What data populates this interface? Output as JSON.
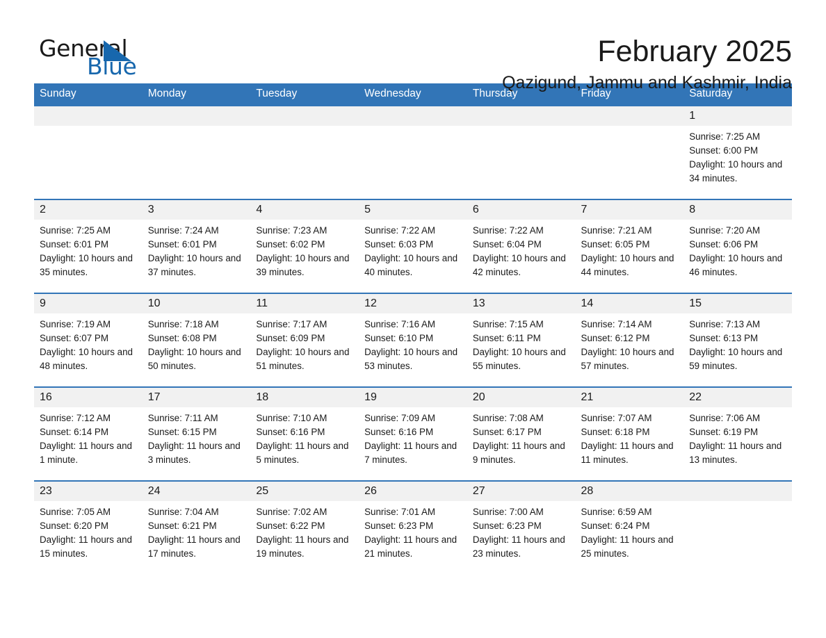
{
  "brand": {
    "name_part1": "General",
    "name_part2": "Blue",
    "flag_icon": "triangle-flag-icon",
    "accent_color": "#1767ad"
  },
  "header": {
    "title": "February 2025",
    "subtitle": "Qazigund, Jammu and Kashmir, India"
  },
  "theme": {
    "header_row_bg": "#3275b7",
    "daynum_bg": "#f1f1f1",
    "row_border": "#3275b7",
    "text": "#1a1a1a"
  },
  "weekday_headers": [
    "Sunday",
    "Monday",
    "Tuesday",
    "Wednesday",
    "Thursday",
    "Friday",
    "Saturday"
  ],
  "weeks": [
    [
      {
        "day": "",
        "sunrise": "",
        "sunset": "",
        "daylight": "",
        "empty": true
      },
      {
        "day": "",
        "sunrise": "",
        "sunset": "",
        "daylight": "",
        "empty": true
      },
      {
        "day": "",
        "sunrise": "",
        "sunset": "",
        "daylight": "",
        "empty": true
      },
      {
        "day": "",
        "sunrise": "",
        "sunset": "",
        "daylight": "",
        "empty": true
      },
      {
        "day": "",
        "sunrise": "",
        "sunset": "",
        "daylight": "",
        "empty": true
      },
      {
        "day": "",
        "sunrise": "",
        "sunset": "",
        "daylight": "",
        "empty": true
      },
      {
        "day": "1",
        "sunrise": "Sunrise: 7:25 AM",
        "sunset": "Sunset: 6:00 PM",
        "daylight": "Daylight: 10 hours and 34 minutes.",
        "empty": false
      }
    ],
    [
      {
        "day": "2",
        "sunrise": "Sunrise: 7:25 AM",
        "sunset": "Sunset: 6:01 PM",
        "daylight": "Daylight: 10 hours and 35 minutes.",
        "empty": false
      },
      {
        "day": "3",
        "sunrise": "Sunrise: 7:24 AM",
        "sunset": "Sunset: 6:01 PM",
        "daylight": "Daylight: 10 hours and 37 minutes.",
        "empty": false
      },
      {
        "day": "4",
        "sunrise": "Sunrise: 7:23 AM",
        "sunset": "Sunset: 6:02 PM",
        "daylight": "Daylight: 10 hours and 39 minutes.",
        "empty": false
      },
      {
        "day": "5",
        "sunrise": "Sunrise: 7:22 AM",
        "sunset": "Sunset: 6:03 PM",
        "daylight": "Daylight: 10 hours and 40 minutes.",
        "empty": false
      },
      {
        "day": "6",
        "sunrise": "Sunrise: 7:22 AM",
        "sunset": "Sunset: 6:04 PM",
        "daylight": "Daylight: 10 hours and 42 minutes.",
        "empty": false
      },
      {
        "day": "7",
        "sunrise": "Sunrise: 7:21 AM",
        "sunset": "Sunset: 6:05 PM",
        "daylight": "Daylight: 10 hours and 44 minutes.",
        "empty": false
      },
      {
        "day": "8",
        "sunrise": "Sunrise: 7:20 AM",
        "sunset": "Sunset: 6:06 PM",
        "daylight": "Daylight: 10 hours and 46 minutes.",
        "empty": false
      }
    ],
    [
      {
        "day": "9",
        "sunrise": "Sunrise: 7:19 AM",
        "sunset": "Sunset: 6:07 PM",
        "daylight": "Daylight: 10 hours and 48 minutes.",
        "empty": false
      },
      {
        "day": "10",
        "sunrise": "Sunrise: 7:18 AM",
        "sunset": "Sunset: 6:08 PM",
        "daylight": "Daylight: 10 hours and 50 minutes.",
        "empty": false
      },
      {
        "day": "11",
        "sunrise": "Sunrise: 7:17 AM",
        "sunset": "Sunset: 6:09 PM",
        "daylight": "Daylight: 10 hours and 51 minutes.",
        "empty": false
      },
      {
        "day": "12",
        "sunrise": "Sunrise: 7:16 AM",
        "sunset": "Sunset: 6:10 PM",
        "daylight": "Daylight: 10 hours and 53 minutes.",
        "empty": false
      },
      {
        "day": "13",
        "sunrise": "Sunrise: 7:15 AM",
        "sunset": "Sunset: 6:11 PM",
        "daylight": "Daylight: 10 hours and 55 minutes.",
        "empty": false
      },
      {
        "day": "14",
        "sunrise": "Sunrise: 7:14 AM",
        "sunset": "Sunset: 6:12 PM",
        "daylight": "Daylight: 10 hours and 57 minutes.",
        "empty": false
      },
      {
        "day": "15",
        "sunrise": "Sunrise: 7:13 AM",
        "sunset": "Sunset: 6:13 PM",
        "daylight": "Daylight: 10 hours and 59 minutes.",
        "empty": false
      }
    ],
    [
      {
        "day": "16",
        "sunrise": "Sunrise: 7:12 AM",
        "sunset": "Sunset: 6:14 PM",
        "daylight": "Daylight: 11 hours and 1 minute.",
        "empty": false
      },
      {
        "day": "17",
        "sunrise": "Sunrise: 7:11 AM",
        "sunset": "Sunset: 6:15 PM",
        "daylight": "Daylight: 11 hours and 3 minutes.",
        "empty": false
      },
      {
        "day": "18",
        "sunrise": "Sunrise: 7:10 AM",
        "sunset": "Sunset: 6:16 PM",
        "daylight": "Daylight: 11 hours and 5 minutes.",
        "empty": false
      },
      {
        "day": "19",
        "sunrise": "Sunrise: 7:09 AM",
        "sunset": "Sunset: 6:16 PM",
        "daylight": "Daylight: 11 hours and 7 minutes.",
        "empty": false
      },
      {
        "day": "20",
        "sunrise": "Sunrise: 7:08 AM",
        "sunset": "Sunset: 6:17 PM",
        "daylight": "Daylight: 11 hours and 9 minutes.",
        "empty": false
      },
      {
        "day": "21",
        "sunrise": "Sunrise: 7:07 AM",
        "sunset": "Sunset: 6:18 PM",
        "daylight": "Daylight: 11 hours and 11 minutes.",
        "empty": false
      },
      {
        "day": "22",
        "sunrise": "Sunrise: 7:06 AM",
        "sunset": "Sunset: 6:19 PM",
        "daylight": "Daylight: 11 hours and 13 minutes.",
        "empty": false
      }
    ],
    [
      {
        "day": "23",
        "sunrise": "Sunrise: 7:05 AM",
        "sunset": "Sunset: 6:20 PM",
        "daylight": "Daylight: 11 hours and 15 minutes.",
        "empty": false
      },
      {
        "day": "24",
        "sunrise": "Sunrise: 7:04 AM",
        "sunset": "Sunset: 6:21 PM",
        "daylight": "Daylight: 11 hours and 17 minutes.",
        "empty": false
      },
      {
        "day": "25",
        "sunrise": "Sunrise: 7:02 AM",
        "sunset": "Sunset: 6:22 PM",
        "daylight": "Daylight: 11 hours and 19 minutes.",
        "empty": false
      },
      {
        "day": "26",
        "sunrise": "Sunrise: 7:01 AM",
        "sunset": "Sunset: 6:23 PM",
        "daylight": "Daylight: 11 hours and 21 minutes.",
        "empty": false
      },
      {
        "day": "27",
        "sunrise": "Sunrise: 7:00 AM",
        "sunset": "Sunset: 6:23 PM",
        "daylight": "Daylight: 11 hours and 23 minutes.",
        "empty": false
      },
      {
        "day": "28",
        "sunrise": "Sunrise: 6:59 AM",
        "sunset": "Sunset: 6:24 PM",
        "daylight": "Daylight: 11 hours and 25 minutes.",
        "empty": false
      },
      {
        "day": "",
        "sunrise": "",
        "sunset": "",
        "daylight": "",
        "empty": true
      }
    ]
  ]
}
